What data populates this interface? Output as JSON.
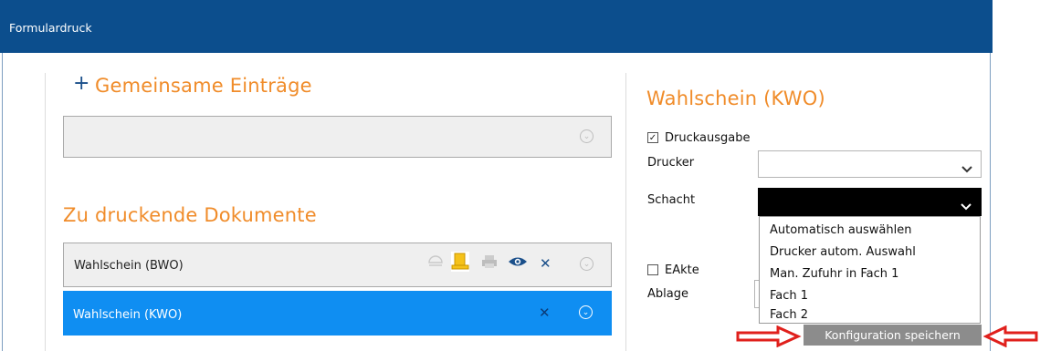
{
  "window": {
    "title": "Formulardruck"
  },
  "left": {
    "common_heading": "Gemeinsame Einträge",
    "common_plus": "+",
    "docs_heading": "Zu druckende Dokumente",
    "documents": [
      {
        "label": "Wahlschein (BWO)",
        "selected": false
      },
      {
        "label": "Wahlschein (KWO)",
        "selected": true
      }
    ]
  },
  "right": {
    "heading": "Wahlschein (KWO)",
    "druckausgabe_label": "Druckausgabe",
    "druckausgabe_checked": true,
    "drucker_label": "Drucker",
    "drucker_value": "",
    "schacht_label": "Schacht",
    "schacht_value": "",
    "schacht_options": [
      "Automatisch auswählen",
      "Drucker autom. Auswahl",
      "Man. Zufuhr in Fach 1",
      "Fach 1",
      "Fach 2"
    ],
    "eakte_label": "EAkte",
    "eakte_checked": false,
    "ablage_label": "Ablage",
    "save_button": "Konfiguration speichern"
  },
  "icons": {
    "check": "✓",
    "chevron": "⌄",
    "close": "✕",
    "circle_chevron": "⌄"
  },
  "colors": {
    "titlebar": "#0c4e8d",
    "accent_orange": "#f08c2a",
    "selected_row": "#0f8ef2",
    "arrow_red": "#e0201c"
  }
}
